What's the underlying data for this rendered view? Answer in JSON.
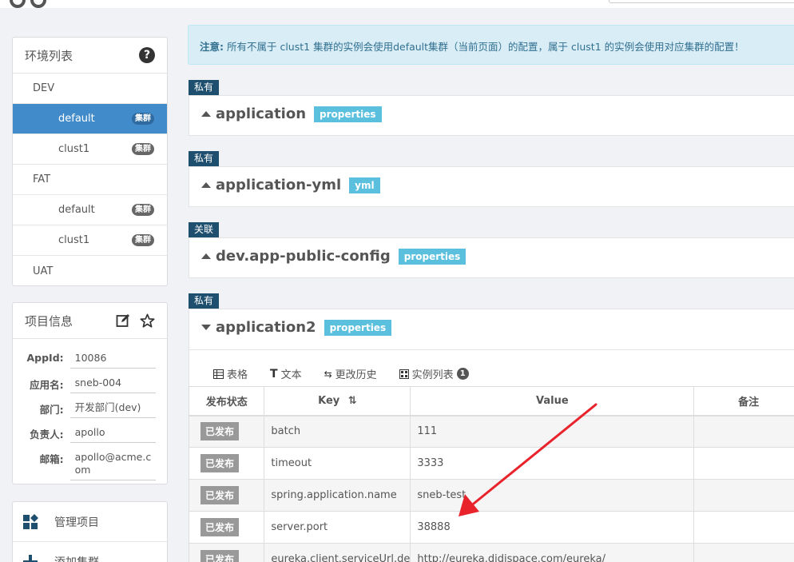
{
  "env_panel": {
    "title": "环境列表",
    "envs": [
      {
        "name": "DEV",
        "clusters": [
          "default",
          "clust1"
        ]
      },
      {
        "name": "FAT",
        "clusters": [
          "default",
          "clust1"
        ]
      },
      {
        "name": "UAT",
        "clusters": []
      }
    ],
    "cluster_badge": "集群",
    "selected": "DEV/default"
  },
  "project_info": {
    "title": "项目信息",
    "rows": [
      {
        "label": "AppId:",
        "value": "10086"
      },
      {
        "label": "应用名:",
        "value": "sneb-004"
      },
      {
        "label": "部门:",
        "value": "开发部门(dev)"
      },
      {
        "label": "负责人:",
        "value": "apollo"
      },
      {
        "label": "邮箱:",
        "value": "apollo@acme.com"
      }
    ]
  },
  "nav": {
    "manage": "管理项目",
    "add_cluster": "添加集群"
  },
  "notice": {
    "label": "注意:",
    "text": "所有不属于 clust1 集群的实例会使用default集群（当前页面）的配置，属于 clust1 的实例会使用对应集群的配置！"
  },
  "namespaces": [
    {
      "tag": "私有",
      "name": "application",
      "format": "properties",
      "expanded": false
    },
    {
      "tag": "私有",
      "name": "application-yml",
      "format": "yml",
      "expanded": false
    },
    {
      "tag": "关联",
      "name": "dev.app-public-config",
      "format": "properties",
      "expanded": false
    },
    {
      "tag": "私有",
      "name": "application2",
      "format": "properties",
      "expanded": true
    }
  ],
  "tabs": {
    "table": "表格",
    "text": "文本",
    "history": "更改历史",
    "instances": "实例列表",
    "instance_count": "1"
  },
  "table": {
    "headers": {
      "status": "发布状态",
      "key": "Key",
      "value": "Value",
      "comment": "备注"
    },
    "published_label": "已发布",
    "rows": [
      {
        "key": "batch",
        "value": "111"
      },
      {
        "key": "timeout",
        "value": "3333"
      },
      {
        "key": "spring.application.name",
        "value": "sneb-test"
      },
      {
        "key": "server.port",
        "value": "38888"
      },
      {
        "key": "eureka.client.serviceUrl.de",
        "value": "http://eureka.didispace.com/eureka/"
      }
    ]
  },
  "colors": {
    "selected_bg": "#428bca",
    "tag_bg": "#1f4f6e",
    "format_badge": "#5bc0de",
    "annotation_arrow": "#e8232b"
  }
}
